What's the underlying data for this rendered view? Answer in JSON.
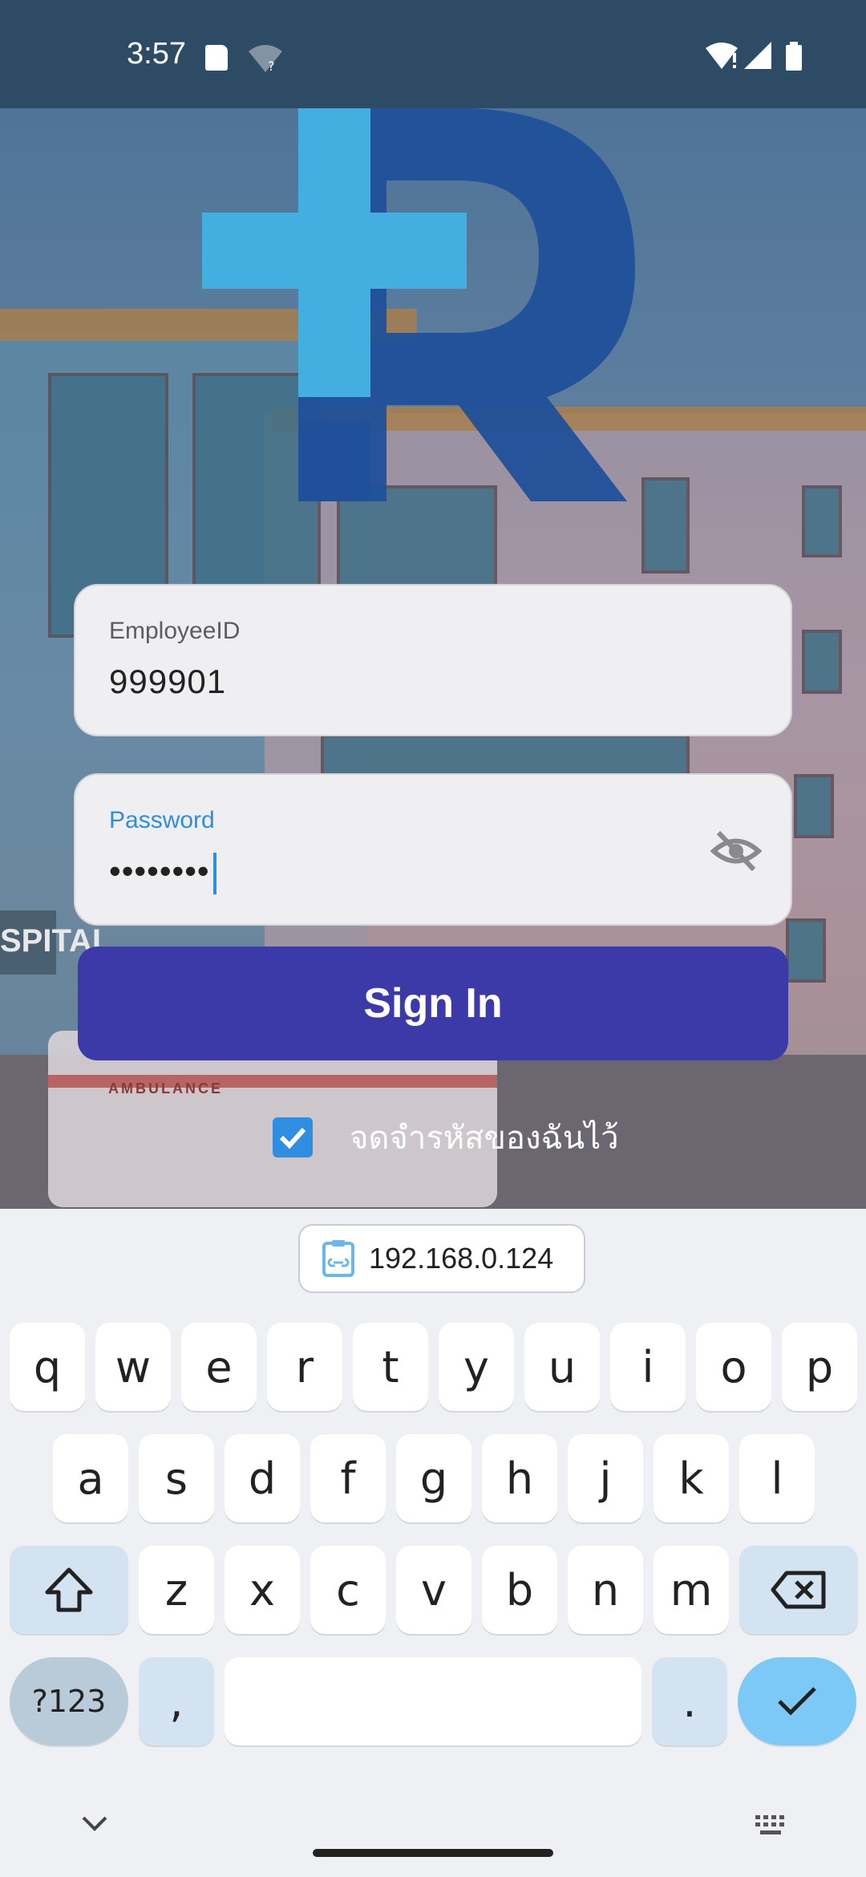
{
  "status_bar": {
    "time": "3:57",
    "icons": [
      "sd-card-icon",
      "wifi-question-icon",
      "wifi-alert-icon",
      "signal-icon",
      "battery-icon"
    ]
  },
  "login": {
    "employee": {
      "label": "EmployeeID",
      "value": "999901"
    },
    "password": {
      "label": "Password",
      "value": "••••••••"
    },
    "signin_label": "Sign In",
    "remember_label": "จดจำรหัสของฉันไว้",
    "remember_checked": true,
    "background_sign_text": "SPITAL",
    "ambulance_text": "AMBULANCE"
  },
  "keyboard": {
    "clipboard_suggestion": "192.168.0.124",
    "row1": [
      "q",
      "w",
      "e",
      "r",
      "t",
      "y",
      "u",
      "i",
      "o",
      "p"
    ],
    "row2": [
      "a",
      "s",
      "d",
      "f",
      "g",
      "h",
      "j",
      "k",
      "l"
    ],
    "row3": [
      "z",
      "x",
      "c",
      "v",
      "b",
      "n",
      "m"
    ],
    "symbols_label": "?123",
    "comma_label": ",",
    "period_label": "."
  },
  "colors": {
    "status_bar": "#2e4b66",
    "primary_button": "#3c3aa8",
    "accent": "#2f8ee0",
    "enter_key": "#7cc8f6"
  }
}
